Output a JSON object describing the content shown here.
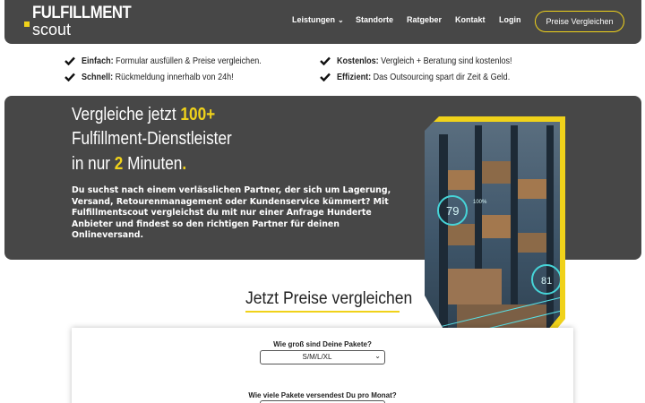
{
  "nav": {
    "logo_top": "FULFILLMENT",
    "logo_bottom": "scout",
    "items": [
      {
        "label": "Leistungen",
        "has_dropdown": true
      },
      {
        "label": "Standorte"
      },
      {
        "label": "Ratgeber"
      },
      {
        "label": "Kontakt"
      },
      {
        "label": "Login"
      }
    ],
    "cta_label": "Preise Vergleichen"
  },
  "benefits": [
    {
      "title": "Einfach:",
      "text": "Formular ausfüllen & Preise vergleichen."
    },
    {
      "title": "Schnell:",
      "text": "Rückmeldung innerhalb von 24h!"
    },
    {
      "title": "Kostenlos:",
      "text": "Vergleich + Beratung sind kostenlos!"
    },
    {
      "title": "Effizient:",
      "text": "Das Outsourcing spart dir Zeit & Geld."
    }
  ],
  "hero": {
    "line1_a": "Vergleiche jetzt ",
    "line1_b": "100+",
    "line2": "Fulfillment-Dienstleister",
    "line3_a": "in nur ",
    "line3_b": "2",
    "line3_c": " Minuten",
    "line3_d": ".",
    "paragraph": "Du suchst nach einem verlässlichen Partner, der sich um Lagerung, Versand, Retourenmanagement oder Kundenservice kümmert? Mit Fulfillmentscout vergleichst du mit nur einer Anfrage Hunderte Anbieter und findest so den richtigen Partner für deinen Onlineversand.",
    "image_overlay_1": "79",
    "image_overlay_2": "81",
    "image_overlay_3": "100%"
  },
  "form": {
    "title": "Jetzt Preise vergleichen",
    "q1_label": "Wie groß sind Deine Pakete?",
    "q1_value": "S/M/L/XL",
    "q2_label": "Wie viele Pakete versendest Du pro Monat?"
  },
  "colors": {
    "accent": "#f0d21a",
    "dark_panel": "#474747"
  }
}
